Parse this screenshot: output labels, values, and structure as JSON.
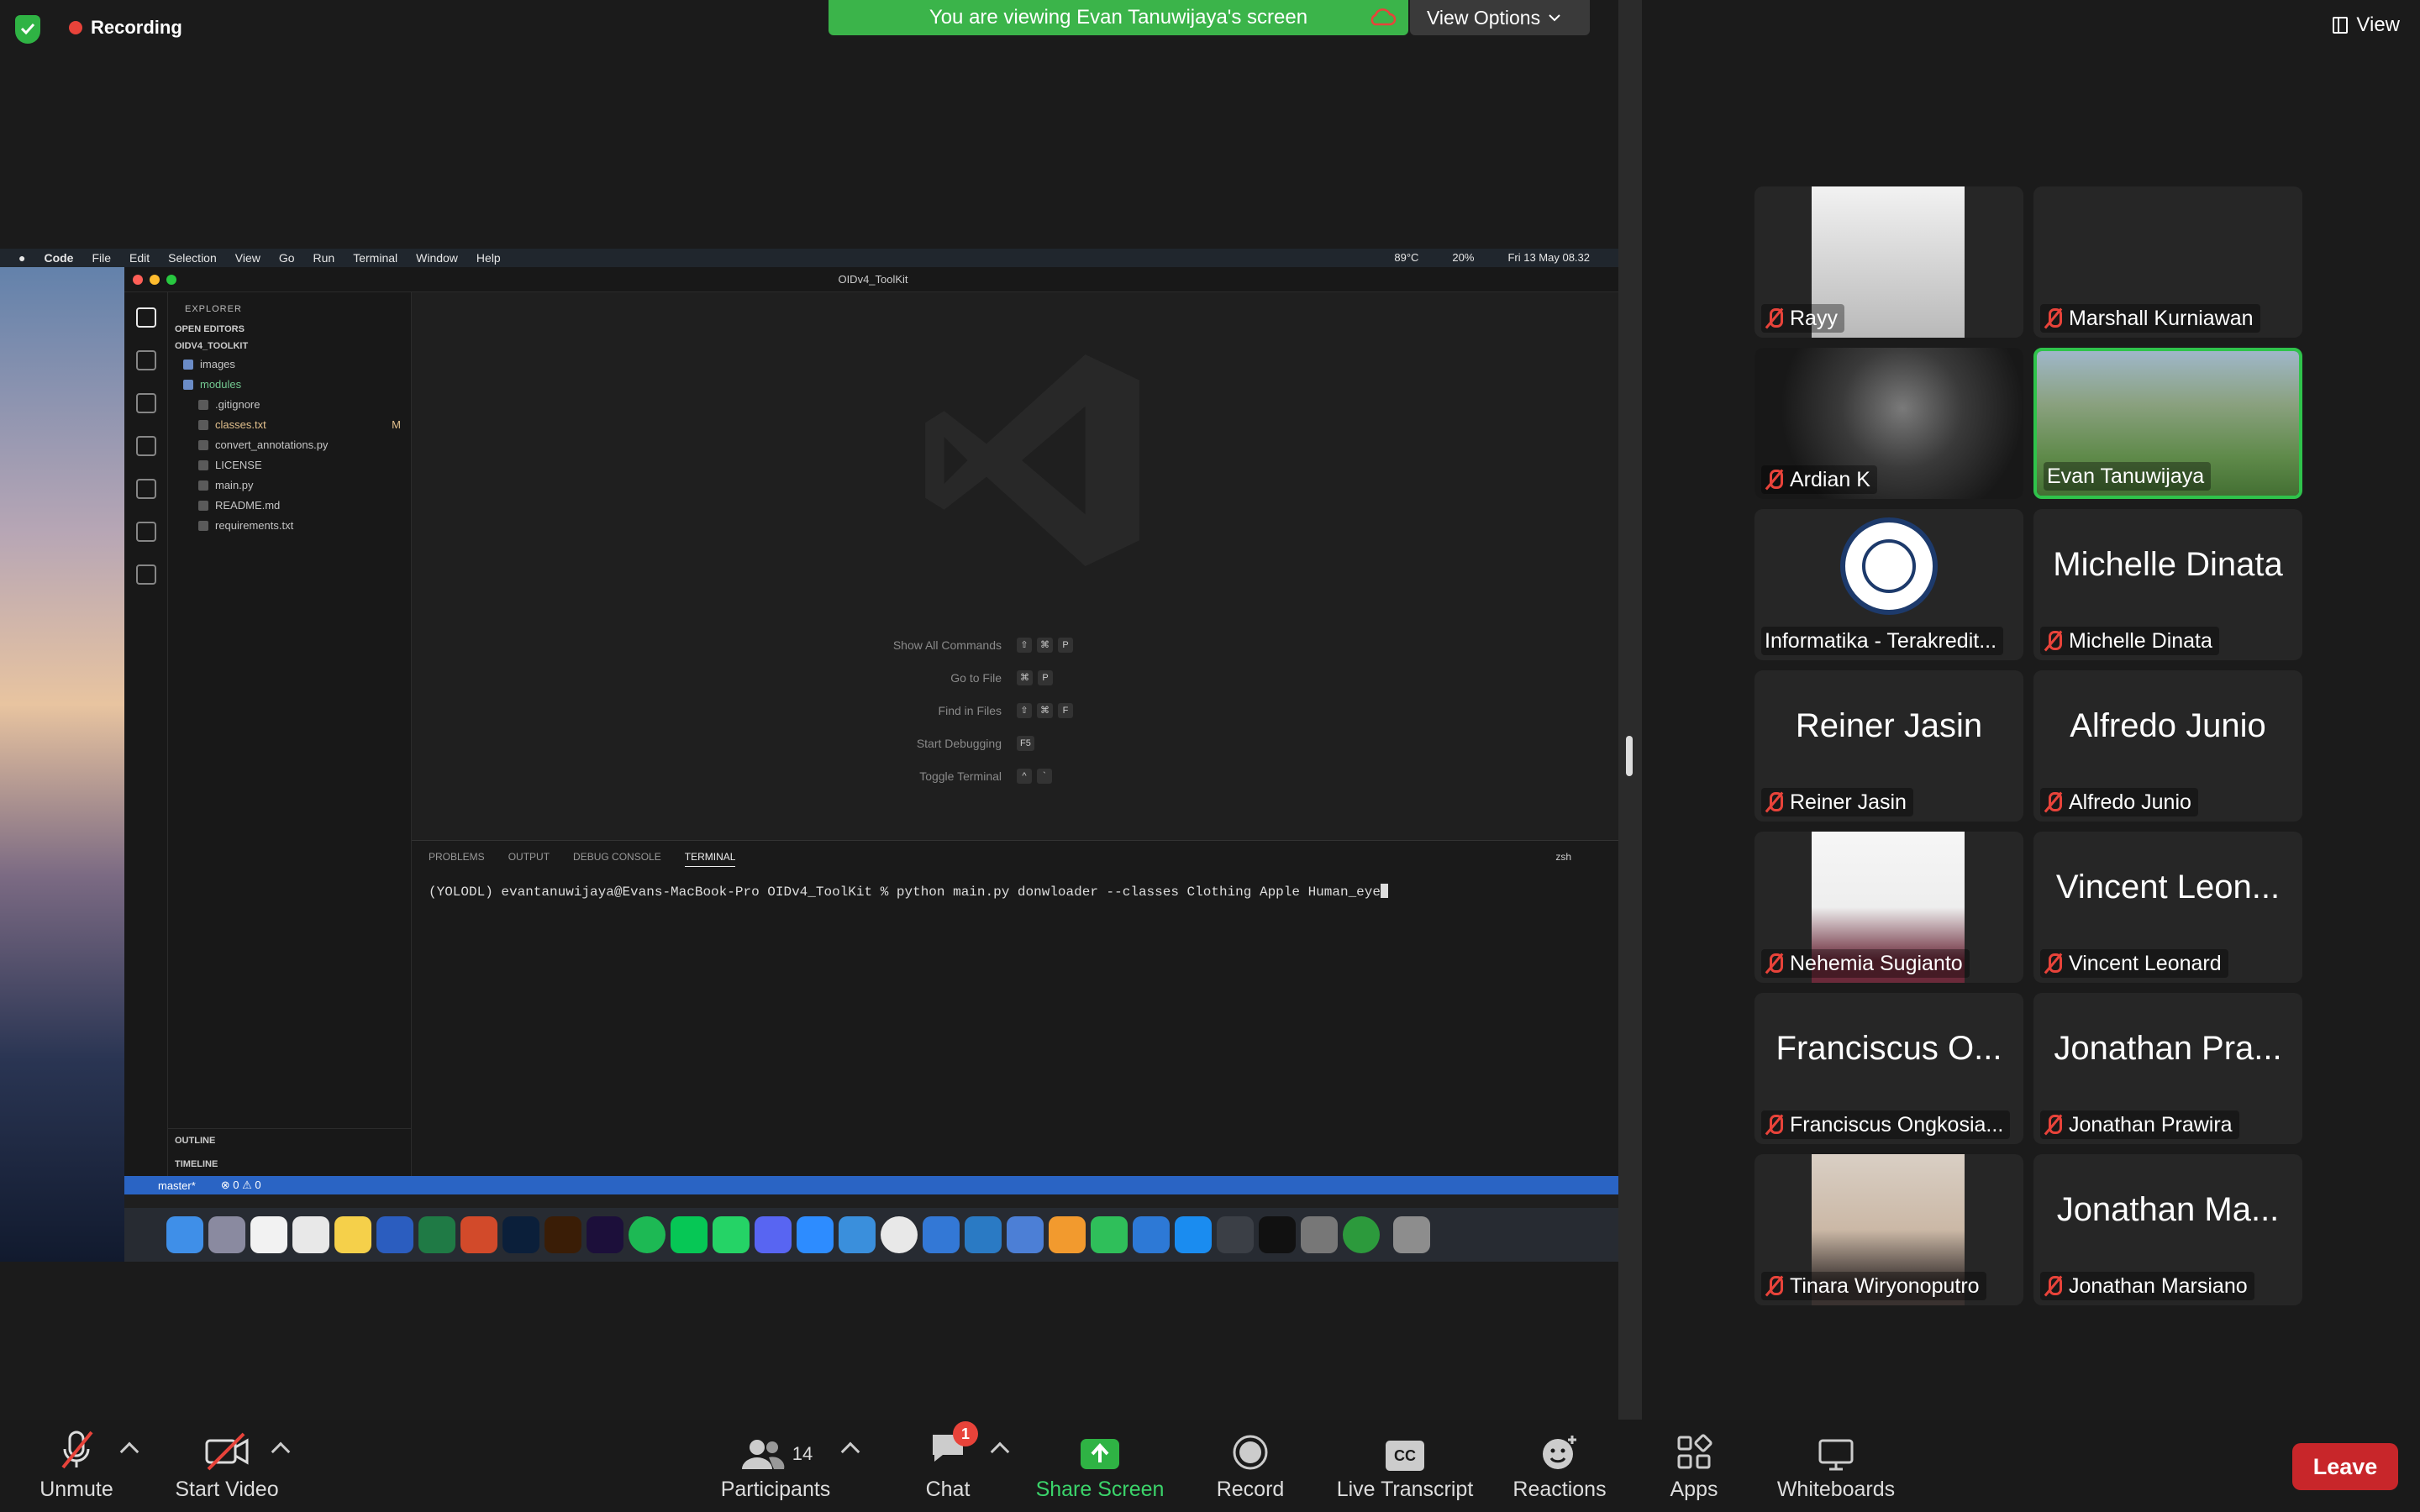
{
  "top_bar": {
    "recording_label": "Recording",
    "sharing_banner": "You are viewing Evan Tanuwijaya's screen",
    "view_options_label": "View Options",
    "view_label": "View"
  },
  "shared_screen": {
    "mac_menu": [
      "Code",
      "File",
      "Edit",
      "Selection",
      "View",
      "Go",
      "Run",
      "Terminal",
      "Window",
      "Help"
    ],
    "mac_status": {
      "temperature": "89°C",
      "battery": "20%",
      "datetime": "Fri 13 May 08.32"
    },
    "window_title": "OIDv4_ToolKit",
    "explorer": {
      "header": "EXPLORER",
      "open_editors": "OPEN EDITORS",
      "project": "OIDV4_TOOLKIT",
      "files": [
        {
          "name": "images",
          "color": "#c5c5c5"
        },
        {
          "name": "modules",
          "color": "#73c991"
        },
        {
          "name": ".gitignore",
          "color": "#c5c5c5"
        },
        {
          "name": "classes.txt",
          "color": "#e2c08d",
          "badge": "M"
        },
        {
          "name": "convert_annotations.py",
          "color": "#c5c5c5"
        },
        {
          "name": "LICENSE",
          "color": "#c5c5c5"
        },
        {
          "name": "main.py",
          "color": "#c5c5c5"
        },
        {
          "name": "README.md",
          "color": "#c5c5c5"
        },
        {
          "name": "requirements.txt",
          "color": "#c5c5c5"
        }
      ],
      "outline": "OUTLINE",
      "timeline": "TIMELINE"
    },
    "editor_hints": [
      {
        "label": "Show All Commands",
        "keys": [
          "⇧",
          "⌘",
          "P"
        ]
      },
      {
        "label": "Go to File",
        "keys": [
          "⌘",
          "P"
        ]
      },
      {
        "label": "Find in Files",
        "keys": [
          "⇧",
          "⌘",
          "F"
        ]
      },
      {
        "label": "Start Debugging",
        "keys": [
          "F5"
        ]
      },
      {
        "label": "Toggle Terminal",
        "keys": [
          "^",
          "`"
        ]
      }
    ],
    "panel_tabs": [
      "PROBLEMS",
      "OUTPUT",
      "DEBUG CONSOLE",
      "TERMINAL"
    ],
    "terminal_shell": "zsh",
    "terminal_line": "(YOLODL) evantanuwijaya@Evans-MacBook-Pro OIDv4_ToolKit % python main.py donwloader --classes Clothing Apple Human_eye",
    "status_branch": "master*",
    "status_problems": "⊗ 0 ⚠ 0"
  },
  "participants": [
    {
      "name": "Rayy",
      "big": "",
      "photo": "ray",
      "muted": true
    },
    {
      "name": "Marshall Kurniawan",
      "big": "",
      "photo": "",
      "muted": true
    },
    {
      "name": "Ardian K",
      "big": "",
      "photo": "cat",
      "muted": true
    },
    {
      "name": "Evan Tanuwijaya",
      "big": "",
      "photo": "evan",
      "muted": false,
      "active": true
    },
    {
      "name": "Informatika - Terakredit...",
      "big": "",
      "photo": "uc",
      "muted": false
    },
    {
      "name": "Michelle Dinata",
      "big": "Michelle Dinata",
      "photo": "",
      "muted": true
    },
    {
      "name": "Reiner Jasin",
      "big": "Reiner Jasin",
      "photo": "",
      "muted": true
    },
    {
      "name": "Alfredo Junio",
      "big": "Alfredo Junio",
      "photo": "",
      "muted": true
    },
    {
      "name": "Nehemia Sugianto",
      "big": "",
      "photo": "nehemia",
      "muted": true
    },
    {
      "name": "Vincent Leonard",
      "big": "Vincent Leon...",
      "photo": "",
      "muted": true
    },
    {
      "name": "Franciscus Ongkosia...",
      "big": "Franciscus O...",
      "photo": "",
      "muted": true
    },
    {
      "name": "Jonathan Prawira",
      "big": "Jonathan Pra...",
      "photo": "",
      "muted": true
    },
    {
      "name": "Tinara Wiryonoputro",
      "big": "",
      "photo": "tinara",
      "muted": true
    },
    {
      "name": "Jonathan Marsiano",
      "big": "Jonathan Ma...",
      "photo": "",
      "muted": true
    }
  ],
  "toolbar": {
    "unmute": "Unmute",
    "start_video": "Start Video",
    "participants": "Participants",
    "participants_count": "14",
    "chat": "Chat",
    "chat_badge": "1",
    "share_screen": "Share Screen",
    "record": "Record",
    "live_transcript": "Live Transcript",
    "reactions": "Reactions",
    "apps": "Apps",
    "whiteboards": "Whiteboards",
    "leave": "Leave"
  },
  "colors": {
    "accent_green": "#2fc34b",
    "mute_red": "#e8433a",
    "leave_red": "#c8262a",
    "vscode_status": "#2a64c4"
  }
}
